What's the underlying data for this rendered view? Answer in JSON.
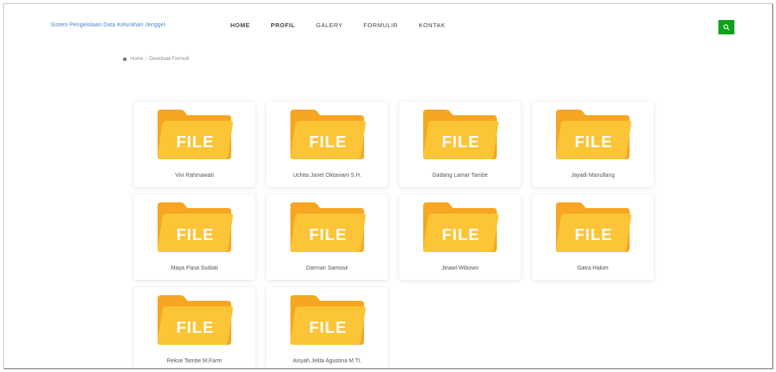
{
  "brand": "Sistem Pengelolaan Data Kelurahan Jenggel",
  "nav": [
    {
      "label": "HOME"
    },
    {
      "label": "PROFIL"
    },
    {
      "label": "GALERY"
    },
    {
      "label": "FORMULIR"
    },
    {
      "label": "KONTAK"
    }
  ],
  "search": {
    "icon": "search-icon"
  },
  "breadcrumb": {
    "home": "Home",
    "separator": "/",
    "current": "Download Formulir"
  },
  "folder": {
    "label": "FILE",
    "color_back": "#f6a623",
    "color_front": "#fcc437"
  },
  "files": [
    {
      "name": "Vivi Rahmawati"
    },
    {
      "name": "Uchita Janet Oktaviani S.H."
    },
    {
      "name": "Gadang Lamar Tambe"
    },
    {
      "name": "Jayadi Manullang"
    },
    {
      "name": "Maya Pana Sudiati"
    },
    {
      "name": "Darman Samosir"
    },
    {
      "name": "Jinawi Wibowo"
    },
    {
      "name": "Gatra Hakim"
    },
    {
      "name": "Rekse Tambe M.Farm"
    },
    {
      "name": "Aisyah Jelita Agustina M.TI."
    }
  ]
}
